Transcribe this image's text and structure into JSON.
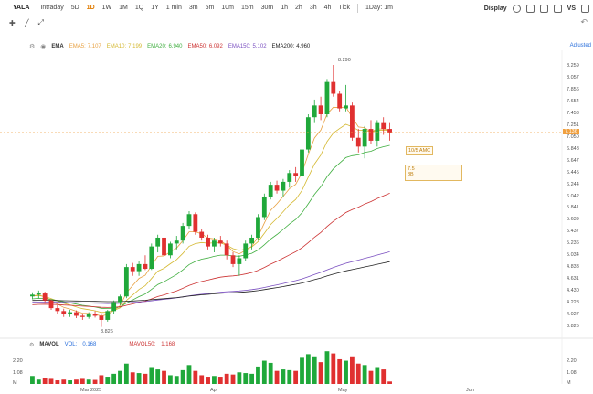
{
  "symbol": "YALA",
  "timeframes": [
    "Intraday",
    "5D",
    "1D",
    "1W",
    "1M",
    "1Q",
    "1Y",
    "1 min",
    "3m",
    "5m",
    "10m",
    "15m",
    "30m",
    "1h",
    "2h",
    "3h",
    "4h",
    "Tick"
  ],
  "active_timeframe": "1D",
  "interval_dropdown": "1Day: 1m",
  "display_label": "Display",
  "vs_label": "VS",
  "adjusted_label": "Adjusted",
  "ema_legend": {
    "label": "EMA",
    "items": [
      {
        "name": "EMA5:",
        "value": "7.107",
        "color": "#e8a040"
      },
      {
        "name": "EMA10:",
        "value": "7.199",
        "color": "#d4b830"
      },
      {
        "name": "EMA20:",
        "value": "6.940",
        "color": "#3fae3f"
      },
      {
        "name": "EMA50:",
        "value": "6.092",
        "color": "#cc3333"
      },
      {
        "name": "EMA150:",
        "value": "5.102",
        "color": "#7a4fc0"
      },
      {
        "name": "EMA200:",
        "value": "4.960",
        "color": "#222222"
      }
    ]
  },
  "mavol_legend": {
    "label": "MAVOL",
    "vol_label": "VOL:",
    "vol_value": "0.168",
    "mavol50_label": "MAVOL50:",
    "mavol50_value": "1.168"
  },
  "price_axis": [
    "8.259",
    "8.057",
    "7.856",
    "7.654",
    "7.453",
    "7.251",
    "7.050",
    "6.848",
    "6.647",
    "6.445",
    "6.244",
    "6.042",
    "5.841",
    "5.639",
    "5.437",
    "5.236",
    "5.034",
    "4.833",
    "4.631",
    "4.430",
    "4.228",
    "4.027",
    "3.825"
  ],
  "current_price": "7.136",
  "high_label": "8.290",
  "low_label": "3.826",
  "volume_axis": [
    "2.20",
    "1.08",
    "M"
  ],
  "x_axis": [
    "Mar 2025",
    "Apr",
    "May",
    "Jun"
  ],
  "annotations": {
    "note1": "10/5 AMC",
    "note2_line1": "7.5",
    "note2_line2": "8B"
  },
  "colors": {
    "up": "#1fa83a",
    "down": "#e03030",
    "accent": "#e07b00"
  },
  "chart_data": {
    "type": "candlestick",
    "candles": [
      [
        4.35,
        4.42,
        4.3,
        4.38
      ],
      [
        4.38,
        4.45,
        4.32,
        4.4
      ],
      [
        4.4,
        4.43,
        4.25,
        4.28
      ],
      [
        4.28,
        4.3,
        4.12,
        4.15
      ],
      [
        4.15,
        4.2,
        4.05,
        4.1
      ],
      [
        4.1,
        4.14,
        4.0,
        4.05
      ],
      [
        4.05,
        4.12,
        4.0,
        4.08
      ],
      [
        4.08,
        4.11,
        3.98,
        4.02
      ],
      [
        4.02,
        4.06,
        3.95,
        4.0
      ],
      [
        4.0,
        4.08,
        3.97,
        4.05
      ],
      [
        4.05,
        4.1,
        3.99,
        4.02
      ],
      [
        4.02,
        4.06,
        3.83,
        3.95
      ],
      [
        3.95,
        4.12,
        3.92,
        4.1
      ],
      [
        4.1,
        4.28,
        4.05,
        4.25
      ],
      [
        4.25,
        4.38,
        4.2,
        4.35
      ],
      [
        4.35,
        4.9,
        4.32,
        4.85
      ],
      [
        4.85,
        4.92,
        4.7,
        4.78
      ],
      [
        4.78,
        4.95,
        4.7,
        4.9
      ],
      [
        4.9,
        5.05,
        4.8,
        4.82
      ],
      [
        4.82,
        5.25,
        4.8,
        5.2
      ],
      [
        5.2,
        5.4,
        5.1,
        5.35
      ],
      [
        5.35,
        5.42,
        4.98,
        5.05
      ],
      [
        5.05,
        5.28,
        5.0,
        5.25
      ],
      [
        5.25,
        5.38,
        5.15,
        5.3
      ],
      [
        5.3,
        5.6,
        5.25,
        5.55
      ],
      [
        5.55,
        5.8,
        5.5,
        5.75
      ],
      [
        5.75,
        5.78,
        5.4,
        5.45
      ],
      [
        5.45,
        5.5,
        5.3,
        5.35
      ],
      [
        5.35,
        5.4,
        5.15,
        5.2
      ],
      [
        5.2,
        5.35,
        5.1,
        5.3
      ],
      [
        5.3,
        5.38,
        5.2,
        5.25
      ],
      [
        5.25,
        5.3,
        4.98,
        5.05
      ],
      [
        5.05,
        5.1,
        4.85,
        4.9
      ],
      [
        4.9,
        5.05,
        4.7,
        5.0
      ],
      [
        5.0,
        5.3,
        4.95,
        5.25
      ],
      [
        5.25,
        5.4,
        5.15,
        5.35
      ],
      [
        5.35,
        5.75,
        5.3,
        5.7
      ],
      [
        5.7,
        6.1,
        5.65,
        6.05
      ],
      [
        6.05,
        6.3,
        6.0,
        6.25
      ],
      [
        6.25,
        6.32,
        6.1,
        6.15
      ],
      [
        6.15,
        6.35,
        6.05,
        6.3
      ],
      [
        6.3,
        6.5,
        6.2,
        6.45
      ],
      [
        6.45,
        6.55,
        6.3,
        6.4
      ],
      [
        6.4,
        6.9,
        6.35,
        6.85
      ],
      [
        6.85,
        7.45,
        6.8,
        7.4
      ],
      [
        7.4,
        7.7,
        7.3,
        7.6
      ],
      [
        7.6,
        7.75,
        7.35,
        7.45
      ],
      [
        7.45,
        8.05,
        7.4,
        8.0
      ],
      [
        8.0,
        8.29,
        7.75,
        7.8
      ],
      [
        7.8,
        7.85,
        7.5,
        7.55
      ],
      [
        7.55,
        7.95,
        7.5,
        7.6
      ],
      [
        7.6,
        7.65,
        7.0,
        7.05
      ],
      [
        7.05,
        7.2,
        6.8,
        6.9
      ],
      [
        6.9,
        7.25,
        6.7,
        7.2
      ],
      [
        7.2,
        7.35,
        6.95,
        7.0
      ],
      [
        7.0,
        7.35,
        6.9,
        7.3
      ],
      [
        7.3,
        7.4,
        7.1,
        7.2
      ],
      [
        7.2,
        7.3,
        7.0,
        7.14
      ]
    ],
    "volumes": [
      0.55,
      0.3,
      0.4,
      0.35,
      0.25,
      0.3,
      0.25,
      0.3,
      0.35,
      0.3,
      0.28,
      0.6,
      0.5,
      0.7,
      0.9,
      1.4,
      0.8,
      0.75,
      0.7,
      1.1,
      1.0,
      0.9,
      0.6,
      0.55,
      0.95,
      1.3,
      0.9,
      0.6,
      0.5,
      0.55,
      0.5,
      0.7,
      0.65,
      0.8,
      0.75,
      0.7,
      1.2,
      1.6,
      1.45,
      0.9,
      1.0,
      0.95,
      0.9,
      1.8,
      2.05,
      1.9,
      1.5,
      2.25,
      2.1,
      1.7,
      1.6,
      1.9,
      1.4,
      1.3,
      0.9,
      1.1,
      1.0,
      0.17
    ],
    "ylim": [
      3.825,
      8.259
    ],
    "volume_ylim": [
      0,
      2.2
    ]
  }
}
